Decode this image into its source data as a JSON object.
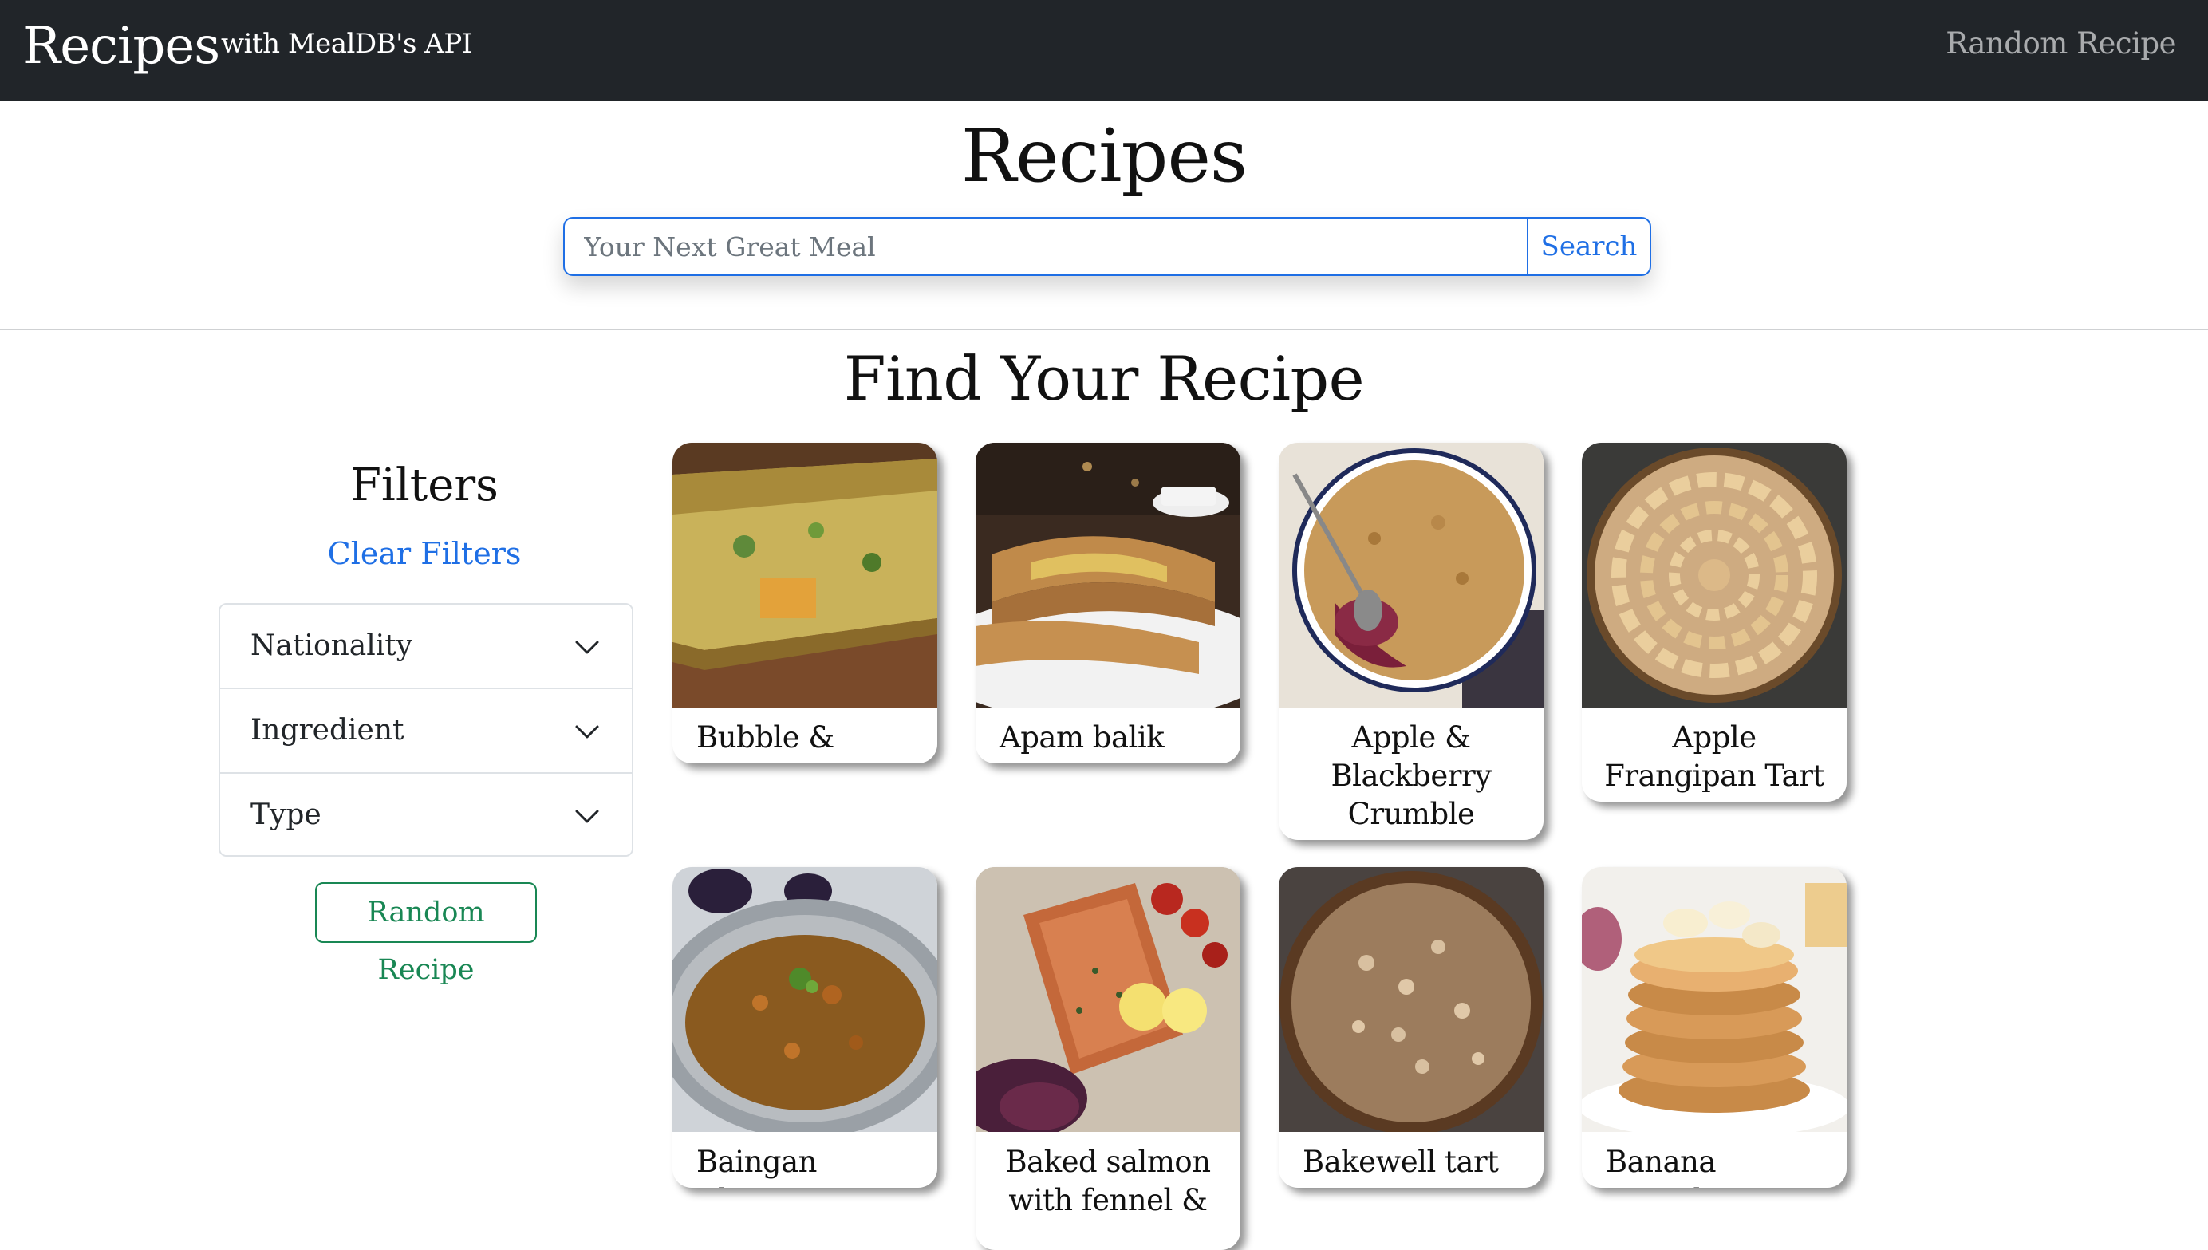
{
  "navbar": {
    "brand": "Recipes",
    "subtitle": "with MealDB's API",
    "random_link": "Random Recipe"
  },
  "hero": {
    "title": "Recipes",
    "search_placeholder": "Your Next Great Meal",
    "search_value": "",
    "search_button": "Search"
  },
  "section": {
    "title": "Find Your Recipe"
  },
  "filters": {
    "title": "Filters",
    "clear_label": "Clear Filters",
    "items": [
      {
        "label": "Nationality",
        "icon": "chevron-down-icon"
      },
      {
        "label": "Ingredient",
        "icon": "chevron-down-icon"
      },
      {
        "label": "Type",
        "icon": "chevron-down-icon"
      }
    ],
    "random_button": "Random Recipe"
  },
  "recipes": [
    {
      "title": "Bubble & Squeak",
      "image": "bubble-squeak-photo"
    },
    {
      "title": "Apam balik",
      "image": "apam-balik-photo"
    },
    {
      "title": "Apple & Blackberry Crumble",
      "image": "crumble-photo"
    },
    {
      "title": "Apple Frangipan Tart",
      "image": "frangipan-tart-photo"
    },
    {
      "title": "Baingan Bharta",
      "image": "baingan-bharta-photo"
    },
    {
      "title": "Baked salmon with fennel &",
      "image": "baked-salmon-photo"
    },
    {
      "title": "Bakewell tart",
      "image": "bakewell-tart-photo"
    },
    {
      "title": "Banana Pancakes",
      "image": "banana-pancakes-photo"
    }
  ],
  "colors": {
    "navbar_bg": "#212529",
    "primary": "#1f6fe5",
    "success": "#198754",
    "muted_link": "#a9abad"
  }
}
